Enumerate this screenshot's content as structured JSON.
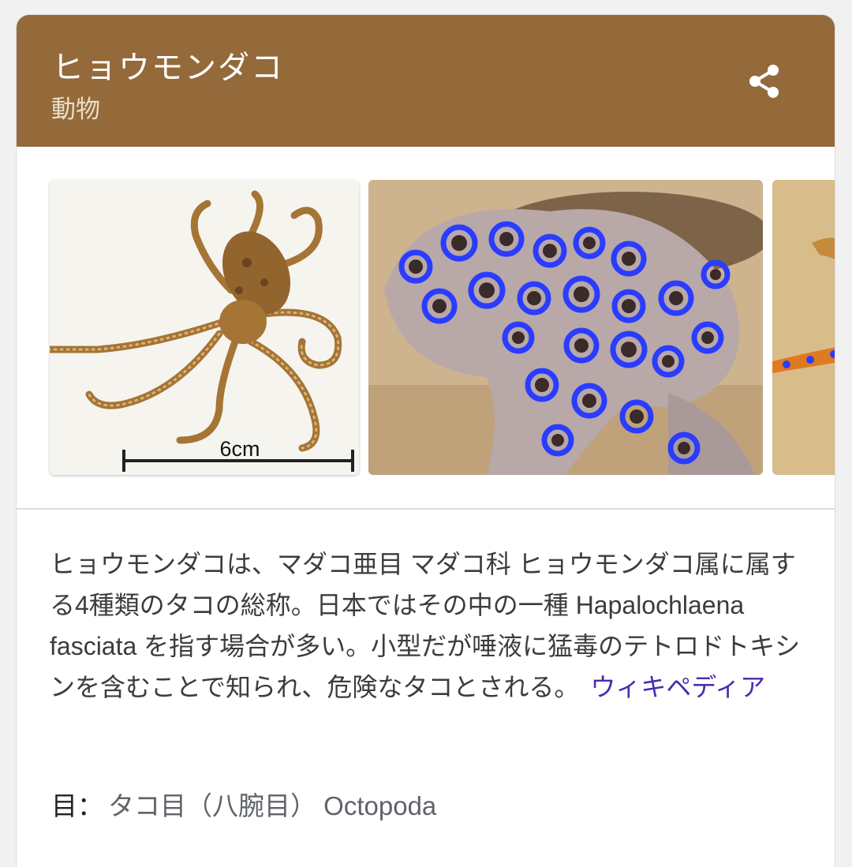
{
  "entity": {
    "title": "ヒョウモンダコ",
    "subtitle": "動物",
    "header_color": "#946a3b"
  },
  "share": {
    "icon": "share-icon"
  },
  "images": [
    {
      "name": "octopus-scale-photo",
      "caption": "6cm"
    },
    {
      "name": "blue-ringed-octopus-closeup"
    },
    {
      "name": "octopus-partial-photo"
    }
  ],
  "description": {
    "text": "ヒョウモンダコは、マダコ亜目 マダコ科 ヒョウモンダコ属に属する4種類のタコの総称。日本ではその中の一種 Hapalochlaena fasciata を指す場合が多い。小型だが唾液に猛毒のテトロドトキシンを含むことで知られ、危険なタコとされる。",
    "source_link": "ウィキペディア",
    "link_color": "#4a2ab0"
  },
  "facts": [
    {
      "label": "目：",
      "value": "タコ目（八腕目） Octopoda"
    },
    {
      "label": "",
      "value": ""
    }
  ]
}
